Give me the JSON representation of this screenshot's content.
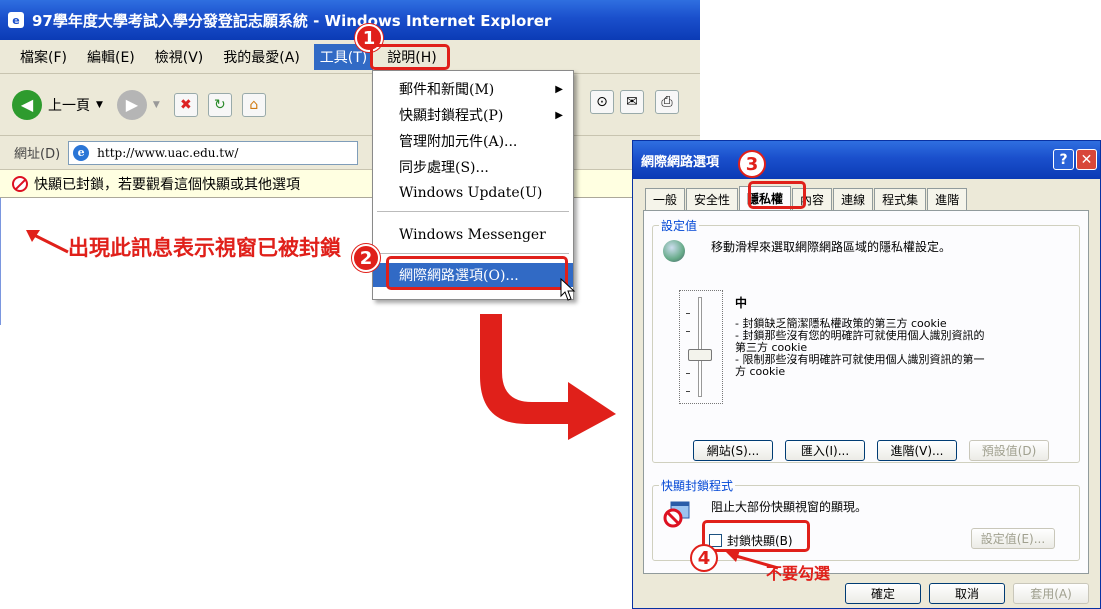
{
  "ie_window": {
    "title": "97學年度大學考試入學分發登記志願系統 - Windows Internet Explorer",
    "menu": [
      "檔案(F)",
      "編輯(E)",
      "檢視(V)",
      "我的最愛(A)",
      "工具(T)",
      "說明(H)"
    ],
    "toolbar": {
      "back_label": "上一頁",
      "back_icon": "back-arrow-icon",
      "forward_icon": "forward-arrow-icon"
    },
    "address_label": "網址(D)",
    "url": "http://www.uac.edu.tw/",
    "infobar_text": "快顯已封鎖，若要觀看這個快顯或其他選項",
    "annotation": "出現此訊息表示視窗已被封鎖"
  },
  "tools_menu": {
    "items": [
      "郵件和新聞(M)",
      "快顯封鎖程式(P)",
      "管理附加元件(A)...",
      "同步處理(S)...",
      "Windows Update(U)",
      "Windows Messenger",
      "網際網路選項(O)..."
    ],
    "highlighted": "網際網路選項(O)..."
  },
  "callouts": [
    "1",
    "2",
    "3",
    "4"
  ],
  "dialog": {
    "title": "網際網路選項",
    "tabs": [
      "一般",
      "安全性",
      "隱私權",
      "內容",
      "連線",
      "程式集",
      "進階"
    ],
    "active_tab": "隱私權",
    "settings_group": "設定值",
    "settings_desc": "移動滑桿來選取網際網路區域的隱私權設定。",
    "level": "中",
    "level_desc": [
      "- 封鎖缺乏簡潔隱私權政策的第三方 cookie",
      "- 封鎖那些沒有您的明確許可就使用個人識別資訊的",
      "第三方 cookie",
      "- 限制那些沒有明確許可就使用個人識別資訊的第一",
      "方 cookie"
    ],
    "privacy_buttons": [
      "網站(S)...",
      "匯入(I)...",
      "進階(V)...",
      "預設值(D)"
    ],
    "popup_group": "快顯封鎖程式",
    "popup_desc": "阻止大部份快顯視窗的顯現。",
    "popup_checkbox": "封鎖快顯(B)",
    "popup_checked": false,
    "popup_settings": "設定值(E)...",
    "note": "不要勾選",
    "bottom_buttons": [
      "確定",
      "取消",
      "套用(A)"
    ]
  },
  "colors": {
    "accent_red": "#e0201a",
    "xp_blue": "#1a4fcc",
    "highlight": "#316ac5"
  }
}
